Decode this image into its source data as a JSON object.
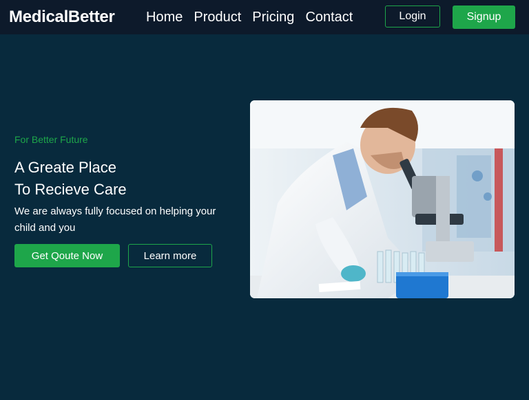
{
  "navbar": {
    "brand": "MedicalBetter",
    "links": [
      "Home",
      "Product",
      "Pricing",
      "Contact"
    ],
    "login_label": "Login",
    "signup_label": "Signup"
  },
  "hero": {
    "tagline": "For Better Future",
    "headline_line1": "A Greate Place",
    "headline_line2": "To Recieve Care",
    "description": "We are always fully focused on helping your child and you",
    "primary_button": "Get Qoute Now",
    "secondary_button": "Learn more"
  },
  "colors": {
    "background": "#082a3d",
    "navbar": "#0d1a2b",
    "accent": "#1ea64a"
  }
}
